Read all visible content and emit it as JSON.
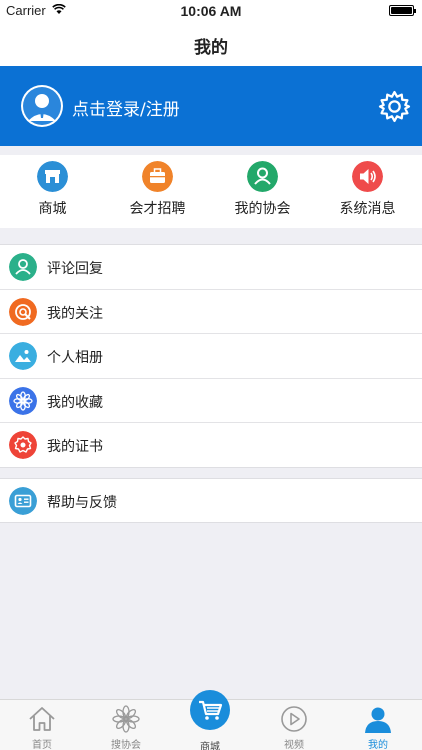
{
  "status_bar": {
    "carrier": "Carrier",
    "time": "10:06 AM"
  },
  "nav": {
    "title": "我的"
  },
  "profile": {
    "login_text": "点击登录/注册"
  },
  "quick_actions": [
    {
      "label": "商城",
      "icon": "store-icon",
      "color": "#2b8fd6"
    },
    {
      "label": "会才招聘",
      "icon": "briefcase-icon",
      "color": "#f0832a"
    },
    {
      "label": "我的协会",
      "icon": "person-icon",
      "color": "#23a86a"
    },
    {
      "label": "系统消息",
      "icon": "speaker-icon",
      "color": "#ef4b4b"
    }
  ],
  "menu": [
    {
      "label": "评论回复",
      "icon": "person-outline-icon",
      "color": "#2bb08a"
    },
    {
      "label": "我的关注",
      "icon": "target-icon",
      "color": "#f06a21"
    },
    {
      "label": "个人相册",
      "icon": "photo-icon",
      "color": "#3aaee0"
    },
    {
      "label": "我的收藏",
      "icon": "flower-icon",
      "color": "#3b73e8"
    },
    {
      "label": "我的证书",
      "icon": "badge-icon",
      "color": "#ee4438"
    }
  ],
  "menu2": [
    {
      "label": "帮助与反馈",
      "icon": "id-card-icon",
      "color": "#3a9fd6"
    }
  ],
  "tabs": [
    {
      "label": "首页",
      "icon": "home-icon"
    },
    {
      "label": "搜协会",
      "icon": "flower-outline-icon"
    },
    {
      "label": "商城",
      "icon": "cart-icon"
    },
    {
      "label": "视频",
      "icon": "play-icon"
    },
    {
      "label": "我的",
      "icon": "user-icon",
      "active": true
    }
  ],
  "colors": {
    "brand": "#0b71d4",
    "tab_active": "#1a8ddb"
  }
}
